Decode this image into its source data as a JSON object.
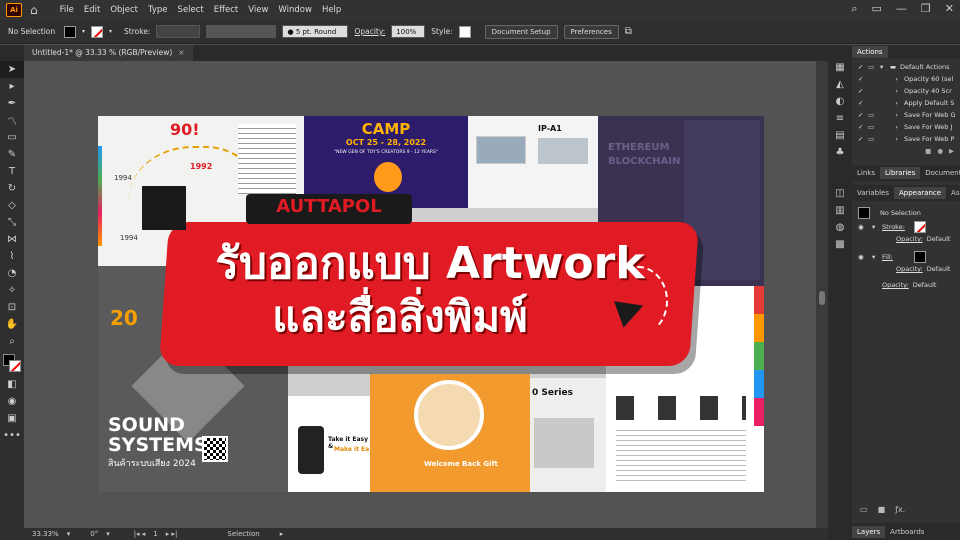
{
  "app": {
    "logo": "Ai"
  },
  "menu": [
    "File",
    "Edit",
    "Object",
    "Type",
    "Select",
    "Effect",
    "View",
    "Window",
    "Help"
  ],
  "control": {
    "selection": "No Selection",
    "stroke_label": "Stroke:",
    "brush": "5 pt. Round",
    "opacity_label": "Opacity:",
    "opacity_value": "100%",
    "style_label": "Style:",
    "doc_setup": "Document Setup",
    "preferences": "Preferences"
  },
  "tab": {
    "title": "Untitled-1* @ 33.33 % (RGB/Preview)",
    "close": "×"
  },
  "status": {
    "zoom": "33.33%",
    "rotate": "0°",
    "artboard": "1",
    "tool": "Selection"
  },
  "artwork": {
    "camp_title": "CAMP",
    "camp_date": "OCT 25 - 28, 2022",
    "camp_sub": "\"NEW GEN OF TOY'S CREATORS 9 - 12 YEARS\"",
    "n90": "90!",
    "year1": "1992",
    "year2": "1994",
    "year3": "1994",
    "ipa": "IP-A1",
    "eth1": "ETHEREUM",
    "eth2": "BLOCKCHAIN",
    "n20": "20",
    "sound1": "SOUND",
    "sound2": "SYSTEMS",
    "sound_th": "สินค้าระบบเสียง 2024",
    "take_easy": "Take it Easy &",
    "make_easy": "Make it Ea",
    "welcome": "Welcome Back Gift",
    "series": "0 Series",
    "banner_top": "AUTTAPOL",
    "banner_line1": "รับออกแบบ Artwork",
    "banner_line2": "และสื่อสิ่งพิมพ์"
  },
  "panel": {
    "tab_actions": "Actions",
    "actions": [
      "Default Actions",
      "Opacity 60 (sel",
      "Opacity 40 Scr",
      "Apply Default S",
      "Save For Web G",
      "Save For Web J",
      "Save For Web P"
    ],
    "tabs_mid": [
      "Links",
      "Libraries",
      "Document"
    ],
    "tabs_app": [
      "Variables",
      "Appearance",
      "Asse"
    ],
    "no_selection": "No Selection",
    "stroke": "Stroke:",
    "fill": "Fill:",
    "opacity": "Opacity:",
    "default": "Default",
    "bottom_tabs": [
      "Layers",
      "Artboards"
    ]
  },
  "colors": {
    "red": "#e01b24",
    "accent_orange": "#ff9a00"
  }
}
